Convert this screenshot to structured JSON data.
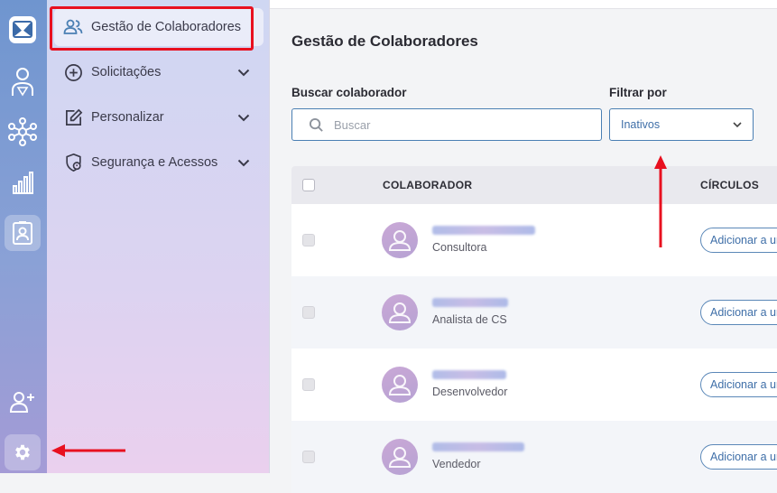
{
  "nav": {
    "items": [
      {
        "label": "Gestão de Colaboradores",
        "icon": "users-icon",
        "active": true
      },
      {
        "label": "Solicitações",
        "icon": "plus-circle-icon",
        "chevron": true
      },
      {
        "label": "Personalizar",
        "icon": "edit-icon",
        "chevron": true
      },
      {
        "label": "Segurança e Acessos",
        "icon": "shield-lock-icon",
        "chevron": true
      }
    ]
  },
  "main": {
    "title": "Gestão de Colaboradores",
    "search": {
      "label": "Buscar colaborador",
      "placeholder": "Buscar",
      "value": ""
    },
    "filter": {
      "label": "Filtrar por",
      "value": "Inativos"
    },
    "table": {
      "headers": [
        "COLABORADOR",
        "CÍRCULOS"
      ],
      "rows": [
        {
          "role": "Consultora",
          "action": "Adicionar a um círculo"
        },
        {
          "role": "Analista de CS",
          "action": "Adicionar a um círculo"
        },
        {
          "role": "Desenvolvedor",
          "action": "Adicionar a um círculo"
        },
        {
          "role": "Vendedor",
          "action": "Adicionar a um círculo"
        }
      ]
    }
  },
  "colors": {
    "accent": "#3f6fa8",
    "highlight": "#e8101f"
  }
}
